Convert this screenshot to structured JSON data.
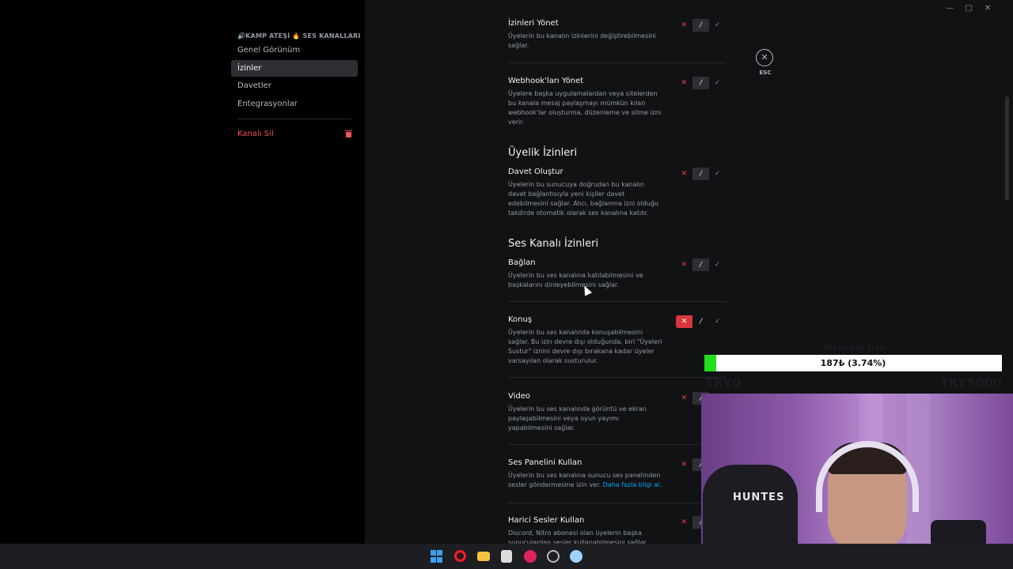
{
  "window": {
    "controls": [
      "—",
      "□",
      "✕"
    ]
  },
  "sidebar": {
    "category": "🔊KAMP ATEŞİ 🔥 SES KANALLARI",
    "items": [
      {
        "label": "Genel Görünüm"
      },
      {
        "label": "İzinler",
        "active": true
      },
      {
        "label": "Davetler"
      },
      {
        "label": "Entegrasyonlar"
      }
    ],
    "danger_label": "Kanalı Sil"
  },
  "permissions": [
    {
      "title": "İzinleri Yönet",
      "desc": "Üyelerin bu kanalın izinlerini değiştirebilmesini sağlar.",
      "state": "neutral"
    },
    {
      "title": "Webhook'ları Yönet",
      "desc": "Üyelere başka uygulamalardan veya sitelerden bu kanala mesaj paylaşmayı mümkün kılan webhook'lar oluşturma, düzenleme ve silme izni verir.",
      "state": "neutral"
    },
    {
      "title": "Davet Oluştur",
      "desc": "Üyelerin bu sunucuya doğrudan bu kanalın davet bağlantısıyla yeni kişiler davet edebilmesini sağlar. Alıcı, bağlanma izni olduğu takdirde otomatik olarak ses kanalına katılır.",
      "state": "neutral"
    },
    {
      "title": "Bağlan",
      "desc": "Üyelerin bu ses kanalına katılabilmesini ve başkalarını dinleyebilmesini sağlar.",
      "state": "neutral"
    },
    {
      "title": "Konuş",
      "desc": "Üyelerin bu ses kanalında konuşabilmesini sağlar. Bu izin devre dışı olduğunda, biri \"Üyeleri Sustur\" iznini devre dışı bırakana kadar üyeler varsayılan olarak susturulur.",
      "state": "deny"
    },
    {
      "title": "Video",
      "desc": "Üyelerin bu ses kanalında görüntü ve ekran paylaşabilmesini veya oyun yayımı yapabilmesini sağlar.",
      "state": "neutral"
    },
    {
      "title": "Ses Panelini Kullan",
      "desc": "Üyelerin bu ses kanalına sunucu ses panelinden sesler göndermesine izin ver.",
      "link": "Daha fazla bilgi al.",
      "state": "neutral"
    },
    {
      "title": "Harici Sesler Kullan",
      "desc": "Discord, Nitro abonesi olan üyelerin başka sunuculardan sesler kullanabilmesini sağlar.",
      "state": "neutral"
    }
  ],
  "sections": {
    "membership": "Üyelik İzinleri",
    "voice": "Ses Kanalı İzinleri"
  },
  "toggle_glyphs": {
    "deny": "✕",
    "neutral": "/",
    "allow": "✓"
  },
  "esc": {
    "icon": "✕",
    "label": "ESC"
  },
  "goal": {
    "title": "Webcam İçin",
    "text": "187₺ (3.74%)",
    "progress": 0.0374,
    "min": "TRY0",
    "max": "TRY5000"
  },
  "webcam": {
    "chair_text": "HUNTES"
  },
  "taskbar_icons": [
    "windows-icon",
    "opera-icon",
    "folder-icon",
    "notepad-icon",
    "media-icon",
    "settings-icon",
    "app-icon"
  ],
  "colors": {
    "accent_deny": "#da373c",
    "link": "#00a8fc",
    "goal_fill": "#22e01b"
  }
}
